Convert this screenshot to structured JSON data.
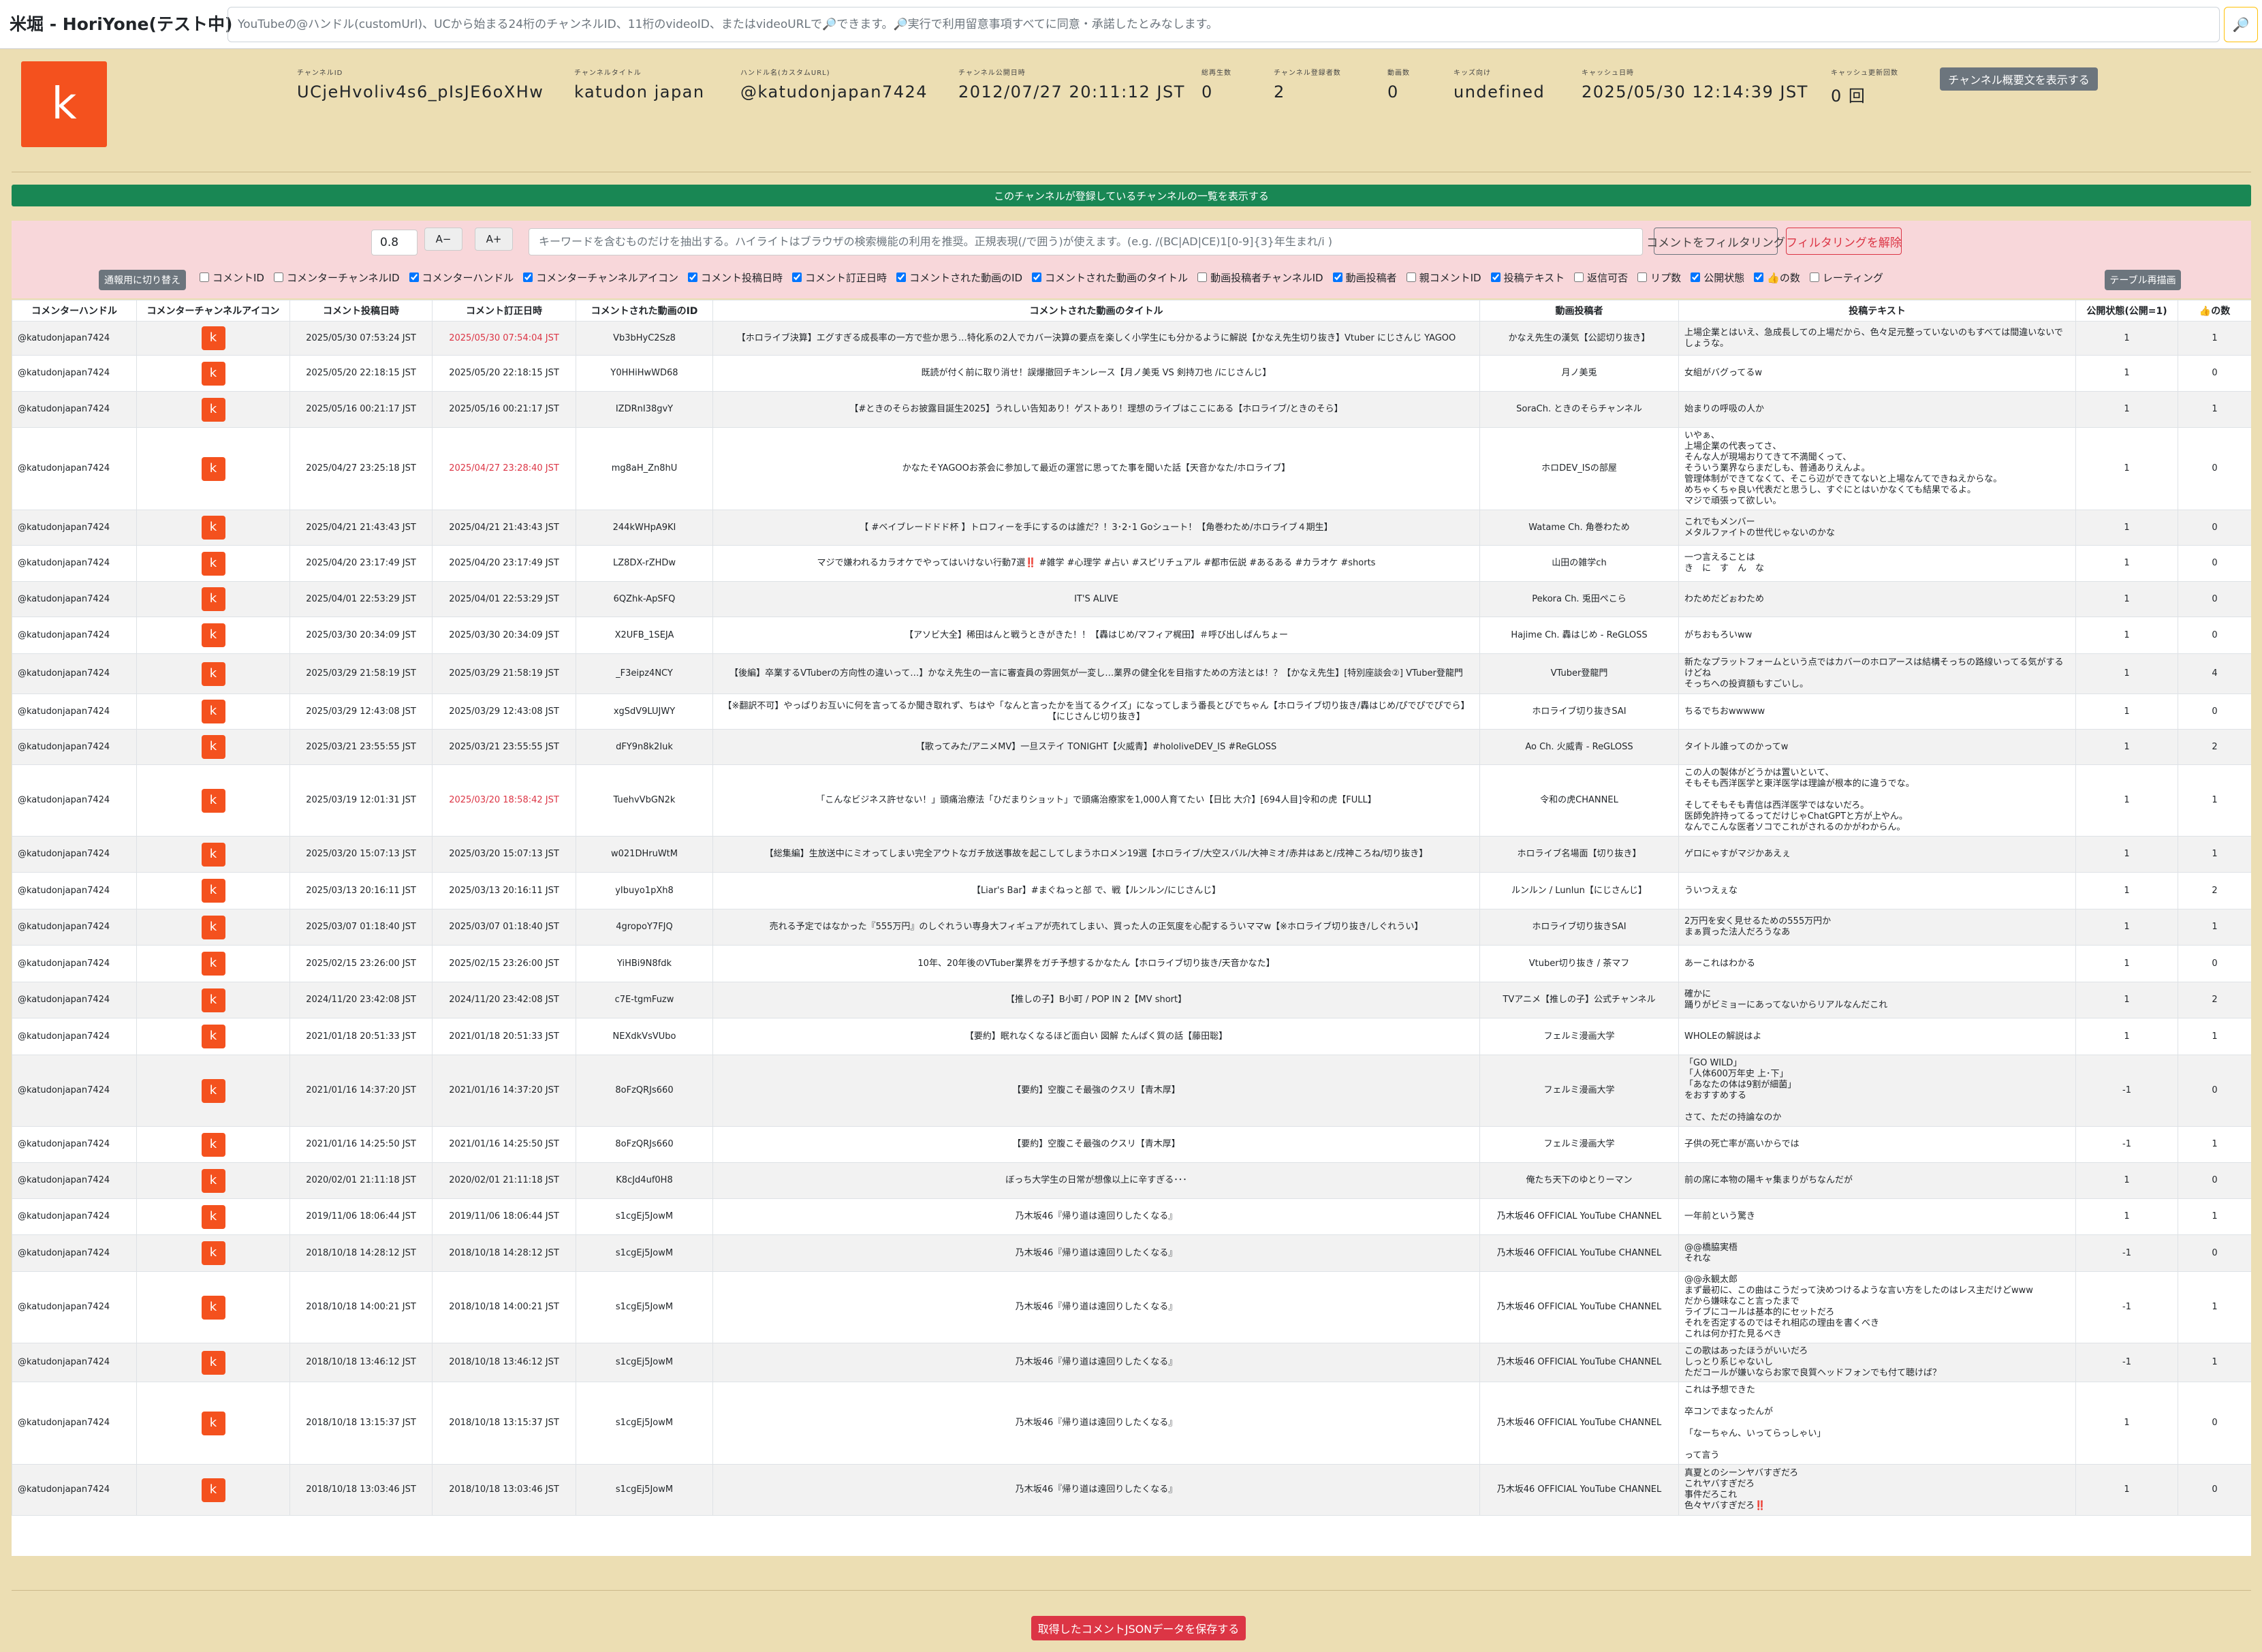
{
  "app": {
    "title": "米堀 - HoriYone(テスト中)",
    "search_placeholder": "YouTubeの@ハンドル(customUrl)、UCから始まる24桁のチャンネルID、11桁のvideoID、またはvideoURLで🔎できます。🔎実行で利用留意事項すべてに同意・承諾したとみなします。",
    "search_icon": "🔎"
  },
  "channel": {
    "avatar_letter": "k",
    "fields": [
      {
        "label": "チャンネルID",
        "value": "UCjeHvoliv4s6_pIsJE6oXHw"
      },
      {
        "label": "チャンネルタイトル",
        "value": "katudon japan"
      },
      {
        "label": "ハンドル名(カスタムURL)",
        "value": "@katudonjapan7424"
      },
      {
        "label": "チャンネル公開日時",
        "value": "2012/07/27 20:11:12 JST"
      },
      {
        "label": "総再生数",
        "value": "0"
      },
      {
        "label": "チャンネル登録者数",
        "value": "2"
      },
      {
        "label": "動画数",
        "value": "0"
      },
      {
        "label": "キッズ向け",
        "value": "undefined"
      },
      {
        "label": "キャッシュ日時",
        "value": "2025/05/30 12:14:39 JST"
      },
      {
        "label": "キャッシュ更新回数",
        "value": "0 回"
      }
    ],
    "summary_button": "チャンネル概要文を表示する"
  },
  "subs_button": "このチャンネルが登録しているチャンネルの一覧を表示する",
  "filter": {
    "ratio": "0.8",
    "font_minus": "A−",
    "font_plus": "A+",
    "keyword_placeholder": "キーワードを含むものだけを抽出する。ハイライトはブラウザの検索機能の利用を推奨。正規表現(/で囲う)が使えます。(e.g. /(BC|AD|CE)1[0-9]{3}年生まれ/i )",
    "filter_button": "コメントをフィルタリング",
    "clear_button": "フィルタリングを解除",
    "switch_button": "通報用に切り替え",
    "redraw_button": "テーブル再描画",
    "columns": [
      {
        "label": "コメントID",
        "checked": false
      },
      {
        "label": "コメンターチャンネルID",
        "checked": false
      },
      {
        "label": "コメンターハンドル",
        "checked": true
      },
      {
        "label": "コメンターチャンネルアイコン",
        "checked": true
      },
      {
        "label": "コメント投稿日時",
        "checked": true
      },
      {
        "label": "コメント訂正日時",
        "checked": true
      },
      {
        "label": "コメントされた動画のID",
        "checked": true
      },
      {
        "label": "コメントされた動画のタイトル",
        "checked": true
      },
      {
        "label": "動画投稿者チャンネルID",
        "checked": false
      },
      {
        "label": "動画投稿者",
        "checked": true
      },
      {
        "label": "親コメントID",
        "checked": false
      },
      {
        "label": "投稿テキスト",
        "checked": true
      },
      {
        "label": "返信可否",
        "checked": false
      },
      {
        "label": "リプ数",
        "checked": false
      },
      {
        "label": "公開状態",
        "checked": true
      },
      {
        "label": "👍の数",
        "checked": true
      },
      {
        "label": "レーティング",
        "checked": false
      }
    ]
  },
  "table": {
    "headers": [
      "コメンターハンドル",
      "コメンターチャンネルアイコン",
      "コメント投稿日時",
      "コメント訂正日時",
      "コメントされた動画のID",
      "コメントされた動画のタイトル",
      "動画投稿者",
      "投稿テキスト",
      "公開状態(公開=1)",
      "👍の数"
    ],
    "rows": [
      {
        "handle": "@katudonjapan7424",
        "icon": "k",
        "posted": "2025/05/30 07:53:24 JST",
        "edited": "2025/05/30 07:54:04 JST",
        "edited_red": true,
        "video_id": "Vb3bHyC2Sz8",
        "title": "【ホロライブ決算】エグすぎる成長率の一方で些か思う…特化系の2人でカバー決算の要点を楽しく小学生にも分かるように解説【かなえ先生切り抜き】Vtuber にじさんじ YAGOO",
        "uploader": "かなえ先生の漢気【公認切り抜き】",
        "text": "上場企業とはいえ、急成長しての上場だから、色々足元整っていないのもすべては間違いないでしょうな。",
        "status": "1",
        "likes": "1"
      },
      {
        "handle": "@katudonjapan7424",
        "icon": "k",
        "posted": "2025/05/20 22:18:15 JST",
        "edited": "2025/05/20 22:18:15 JST",
        "edited_red": false,
        "video_id": "Y0HHiHwWD68",
        "title": "既読が付く前に取り消せ！誤爆撤回チキンレース【月ノ美兎 VS 剣持刀也 /にじさんじ】",
        "uploader": "月ノ美兎",
        "text": "女組がバグってるw",
        "status": "1",
        "likes": "0"
      },
      {
        "handle": "@katudonjapan7424",
        "icon": "k",
        "posted": "2025/05/16 00:21:17 JST",
        "edited": "2025/05/16 00:21:17 JST",
        "edited_red": false,
        "video_id": "IZDRnI38gvY",
        "title": "【#ときのそらお披露目誕生2025】うれしい告知あり！ゲストあり！理想のライブはここにある【ホロライブ/ときのそら】",
        "uploader": "SoraCh. ときのそらチャンネル",
        "text": "始まりの呼吸の人か",
        "status": "1",
        "likes": "1"
      },
      {
        "handle": "@katudonjapan7424",
        "icon": "k",
        "posted": "2025/04/27 23:25:18 JST",
        "edited": "2025/04/27 23:28:40 JST",
        "edited_red": true,
        "video_id": "mg8aH_Zn8hU",
        "title": "かなたそYAGOOお茶会に参加して最近の運営に思ってた事を聞いた話【天音かなた/ホロライブ】",
        "uploader": "ホロDEV_ISの部屋",
        "text": "いやぁ、\n上場企業の代表ってさ、\nそんな人が現場おりてきて不満聞くって、\nそういう業界ならまだしも、普通ありえんよ。\n管理体制ができてなくて、そこら辺ができてないと上場なんてできねえからな。\nめちゃくちゃ良い代表だと思うし、すぐにとはいかなくても結果でるよ。\nマジで頑張って欲しい。",
        "status": "1",
        "likes": "0"
      },
      {
        "handle": "@katudonjapan7424",
        "icon": "k",
        "posted": "2025/04/21 21:43:43 JST",
        "edited": "2025/04/21 21:43:43 JST",
        "edited_red": false,
        "video_id": "244kWHpA9KI",
        "title": "【 #ベイブレードドド杯 】トロフィーを手にするのは誰だ？！3･2･1 Goシュート！【角巻わため/ホロライブ４期生】",
        "uploader": "Watame Ch. 角巻わため",
        "text": "これでもメンバー\nメタルファイトの世代じゃないのかな",
        "status": "1",
        "likes": "0"
      },
      {
        "handle": "@katudonjapan7424",
        "icon": "k",
        "posted": "2025/04/20 23:17:49 JST",
        "edited": "2025/04/20 23:17:49 JST",
        "edited_red": false,
        "video_id": "LZ8DX-rZHDw",
        "title": "マジで嫌われるカラオケでやってはいけない行動7選‼️ #雑学 #心理学 #占い #スピリチュアル #都市伝説 #あるある #カラオケ #shorts",
        "uploader": "山田の雑学ch",
        "text": "一つ言えることは\nき　に　す　ん　な",
        "status": "1",
        "likes": "0"
      },
      {
        "handle": "@katudonjapan7424",
        "icon": "k",
        "posted": "2025/04/01 22:53:29 JST",
        "edited": "2025/04/01 22:53:29 JST",
        "edited_red": false,
        "video_id": "6QZhk-ApSFQ",
        "title": "IT'S ALIVE",
        "uploader": "Pekora Ch. 兎田ぺこら",
        "text": "わためだどぉわため",
        "status": "1",
        "likes": "0"
      },
      {
        "handle": "@katudonjapan7424",
        "icon": "k",
        "posted": "2025/03/30 20:34:09 JST",
        "edited": "2025/03/30 20:34:09 JST",
        "edited_red": false,
        "video_id": "X2UFB_1SEJA",
        "title": "【アソビ大全】稀田はんと戦うときがきた！！【轟はじめ/マフィア梶田】＃呼び出しばんちょー",
        "uploader": "Hajime Ch. 轟はじめ - ReGLOSS",
        "text": "がちおもろいww",
        "status": "1",
        "likes": "0"
      },
      {
        "handle": "@katudonjapan7424",
        "icon": "k",
        "posted": "2025/03/29 21:58:19 JST",
        "edited": "2025/03/29 21:58:19 JST",
        "edited_red": false,
        "video_id": "_F3eipz4NCY",
        "title": "【後編】卒業するVTuberの方向性の違いって…】かなえ先生の一言に審査員の雰囲気が一変し…業界の健全化を目指すための方法とは！？【かなえ先生】[特別座談会②] VTuber登龍門",
        "uploader": "VTuber登龍門",
        "text": "新たなプラットフォームという点ではカバーのホロアースは結構そっちの路線いってる気がするけどね\nそっちへの投資額もすごいし。",
        "status": "1",
        "likes": "4"
      },
      {
        "handle": "@katudonjapan7424",
        "icon": "k",
        "posted": "2025/03/29 12:43:08 JST",
        "edited": "2025/03/29 12:43:08 JST",
        "edited_red": false,
        "video_id": "xgSdV9LUJWY",
        "title": "【※翻訳不可】やっぱりお互いに何を言ってるか聞き取れず、ちはや「なんと言ったかを当てるクイズ」になってしまう番長とびでちゃん【ホロライブ切り抜き/轟はじめ/ぴでぴでぴでら】【にじさんじ切り抜き】",
        "uploader": "ホロライブ切り抜きSAI",
        "text": "ちるでちおwwwww",
        "status": "1",
        "likes": "0"
      },
      {
        "handle": "@katudonjapan7424",
        "icon": "k",
        "posted": "2025/03/21 23:55:55 JST",
        "edited": "2025/03/21 23:55:55 JST",
        "edited_red": false,
        "video_id": "dFY9n8k2Iuk",
        "title": "【歌ってみた/アニメMV】一旦ステイ TONIGHT【火威青】#hololiveDEV_IS #ReGLOSS",
        "uploader": "Ao Ch. 火威青 - ReGLOSS",
        "text": "タイトル誰ってのかってw",
        "status": "1",
        "likes": "2"
      },
      {
        "handle": "@katudonjapan7424",
        "icon": "k",
        "posted": "2025/03/19 12:01:31 JST",
        "edited": "2025/03/20 18:58:42 JST",
        "edited_red": true,
        "video_id": "TuehvVbGN2k",
        "title": "「こんなビジネス許せない！」頭痛治療法「ひだまりショット」で頭痛治療家を1,000人育てたい【日比 大介】[694人目]令和の虎【FULL】",
        "uploader": "令和の虎CHANNEL",
        "text": "この人の製体がどうかは置いといて、\nそもそも西洋医学と東洋医学は理論が根本的に違うでな。\n\nそしてそもそも青信は西洋医学ではないだろ。\n医師免許持ってるってだけじゃChatGPTと方が上やん。\nなんでこんな医者ソコでこれがされるのかがわからん。",
        "status": "1",
        "likes": "1"
      },
      {
        "handle": "@katudonjapan7424",
        "icon": "k",
        "posted": "2025/03/20 15:07:13 JST",
        "edited": "2025/03/20 15:07:13 JST",
        "edited_red": false,
        "video_id": "w021DHruWtM",
        "title": "【総集編】生放送中にミオってしまい完全アウトなガチ放送事故を起こしてしまうホロメン19選【ホロライブ/大空スバル/大神ミオ/赤井はあと/戌神ころね/切り抜き】",
        "uploader": "ホロライブ名場面【切り抜き】",
        "text": "ゲロにゃすがマジかあえぇ",
        "status": "1",
        "likes": "1"
      },
      {
        "handle": "@katudonjapan7424",
        "icon": "k",
        "posted": "2025/03/13 20:16:11 JST",
        "edited": "2025/03/13 20:16:11 JST",
        "edited_red": false,
        "video_id": "yIbuyo1pXh8",
        "title": "【Liar's Bar】#まぐねっと部 で、戦【ルンルン/にじさんじ】",
        "uploader": "ルンルン / Lunlun【にじさんじ】",
        "text": "ういつえぇな",
        "status": "1",
        "likes": "2"
      },
      {
        "handle": "@katudonjapan7424",
        "icon": "k",
        "posted": "2025/03/07 01:18:40 JST",
        "edited": "2025/03/07 01:18:40 JST",
        "edited_red": false,
        "video_id": "4gropoY7FJQ",
        "title": "売れる予定ではなかった『555万円』のしぐれうい専身大フィギュアが売れてしまい、買った人の正気度を心配するういママw【※ホロライブ切り抜き/しぐれうい】",
        "uploader": "ホロライブ切り抜きSAI",
        "text": "2万円を安く見せるための555万円か\nまぁ買った法人だろうなあ",
        "status": "1",
        "likes": "1"
      },
      {
        "handle": "@katudonjapan7424",
        "icon": "k",
        "posted": "2025/02/15 23:26:00 JST",
        "edited": "2025/02/15 23:26:00 JST",
        "edited_red": false,
        "video_id": "YiHBi9N8fdk",
        "title": "10年、20年後のVTuber業界をガチ予想するかなたん【ホロライブ切り抜き/天音かなた】",
        "uploader": "Vtuber切り抜き / 茶マフ",
        "text": "あーこれはわかる",
        "status": "1",
        "likes": "0"
      },
      {
        "handle": "@katudonjapan7424",
        "icon": "k",
        "posted": "2024/11/20 23:42:08 JST",
        "edited": "2024/11/20 23:42:08 JST",
        "edited_red": false,
        "video_id": "c7E-tgmFuzw",
        "title": "【推しの子】B小町 / POP IN 2【MV short】",
        "uploader": "TVアニメ【推しの子】公式チャンネル",
        "text": "確かに\n踊りがビミョーにあってないからリアルなんだこれ",
        "status": "1",
        "likes": "2"
      },
      {
        "handle": "@katudonjapan7424",
        "icon": "k",
        "posted": "2021/01/18 20:51:33 JST",
        "edited": "2021/01/18 20:51:33 JST",
        "edited_red": false,
        "video_id": "NEXdkVsVUbo",
        "title": "【要約】眠れなくなるほど面白い 図解 たんぱく質の話【藤田聡】",
        "uploader": "フェルミ漫画大学",
        "text": "WHOLEの解説はよ",
        "status": "1",
        "likes": "1"
      },
      {
        "handle": "@katudonjapan7424",
        "icon": "k",
        "posted": "2021/01/16 14:37:20 JST",
        "edited": "2021/01/16 14:37:20 JST",
        "edited_red": false,
        "video_id": "8oFzQRJs660",
        "title": "【要約】空腹こそ最強のクスリ【青木厚】",
        "uploader": "フェルミ漫画大学",
        "text": "「GO WILD」\n「人体600万年史 上･下」\n「あなたの体は9割が細菌」\nをおすすめする\n\nさて、ただの持論なのか",
        "status": "-1",
        "likes": "0"
      },
      {
        "handle": "@katudonjapan7424",
        "icon": "k",
        "posted": "2021/01/16 14:25:50 JST",
        "edited": "2021/01/16 14:25:50 JST",
        "edited_red": false,
        "video_id": "8oFzQRJs660",
        "title": "【要約】空腹こそ最強のクスリ【青木厚】",
        "uploader": "フェルミ漫画大学",
        "text": "子供の死亡率が高いからでは",
        "status": "-1",
        "likes": "1"
      },
      {
        "handle": "@katudonjapan7424",
        "icon": "k",
        "posted": "2020/02/01 21:11:18 JST",
        "edited": "2020/02/01 21:11:18 JST",
        "edited_red": false,
        "video_id": "K8cJd4uf0H8",
        "title": "ぼっち大学生の日常が想像以上に辛すぎる･･･",
        "uploader": "俺たち天下のゆとりーマン",
        "text": "前の席に本物の陽キャ集まりがちなんだが",
        "status": "1",
        "likes": "0"
      },
      {
        "handle": "@katudonjapan7424",
        "icon": "k",
        "posted": "2019/11/06 18:06:44 JST",
        "edited": "2019/11/06 18:06:44 JST",
        "edited_red": false,
        "video_id": "s1cgEj5JowM",
        "title": "乃木坂46『帰り道は遠回りしたくなる』",
        "uploader": "乃木坂46 OFFICIAL YouTube CHANNEL",
        "text": "一年前という驚き",
        "status": "1",
        "likes": "1"
      },
      {
        "handle": "@katudonjapan7424",
        "icon": "k",
        "posted": "2018/10/18 14:28:12 JST",
        "edited": "2018/10/18 14:28:12 JST",
        "edited_red": false,
        "video_id": "s1cgEj5JowM",
        "title": "乃木坂46『帰り道は遠回りしたくなる』",
        "uploader": "乃木坂46 OFFICIAL YouTube CHANNEL",
        "text": "@@橋脇実梧\nそれな",
        "status": "-1",
        "likes": "0"
      },
      {
        "handle": "@katudonjapan7424",
        "icon": "k",
        "posted": "2018/10/18 14:00:21 JST",
        "edited": "2018/10/18 14:00:21 JST",
        "edited_red": false,
        "video_id": "s1cgEj5JowM",
        "title": "乃木坂46『帰り道は遠回りしたくなる』",
        "uploader": "乃木坂46 OFFICIAL YouTube CHANNEL",
        "text": "@@永観太郎\nまず最初に、この曲はこうだって決めつけるような言い方をしたのはレス主だけどwww\nだから嫌味なこと言ったまで\nライブにコールは基本的にセットだろ\nそれを否定するのではそれ相応の理由を書くべき\nこれは何か打た見るべき",
        "status": "-1",
        "likes": "1"
      },
      {
        "handle": "@katudonjapan7424",
        "icon": "k",
        "posted": "2018/10/18 13:46:12 JST",
        "edited": "2018/10/18 13:46:12 JST",
        "edited_red": false,
        "video_id": "s1cgEj5JowM",
        "title": "乃木坂46『帰り道は遠回りしたくなる』",
        "uploader": "乃木坂46 OFFICIAL YouTube CHANNEL",
        "text": "この歌はあったほうがいいだろ\nしっとり系じゃないし\nただコールが嫌いならお家で良質ヘッドフォンでも付て聴けば？",
        "status": "-1",
        "likes": "1"
      },
      {
        "handle": "@katudonjapan7424",
        "icon": "k",
        "posted": "2018/10/18 13:15:37 JST",
        "edited": "2018/10/18 13:15:37 JST",
        "edited_red": false,
        "video_id": "s1cgEj5JowM",
        "title": "乃木坂46『帰り道は遠回りしたくなる』",
        "uploader": "乃木坂46 OFFICIAL YouTube CHANNEL",
        "text": "これは予想できた\n\n卒コンでまなったんが\n\n「なーちゃん、いってらっしゃい」\n\nって言う",
        "status": "1",
        "likes": "0"
      },
      {
        "handle": "@katudonjapan7424",
        "icon": "k",
        "posted": "2018/10/18 13:03:46 JST",
        "edited": "2018/10/18 13:03:46 JST",
        "edited_red": false,
        "video_id": "s1cgEj5JowM",
        "title": "乃木坂46『帰り道は遠回りしたくなる』",
        "uploader": "乃木坂46 OFFICIAL YouTube CHANNEL",
        "text": "真夏とのシーンヤバすぎだろ\nこれヤバすぎだろ\n事件だろこれ\n色々ヤバすぎだろ‼️",
        "status": "1",
        "likes": "0"
      }
    ]
  },
  "save_button": "取得したコメントJSONデータを保存する"
}
